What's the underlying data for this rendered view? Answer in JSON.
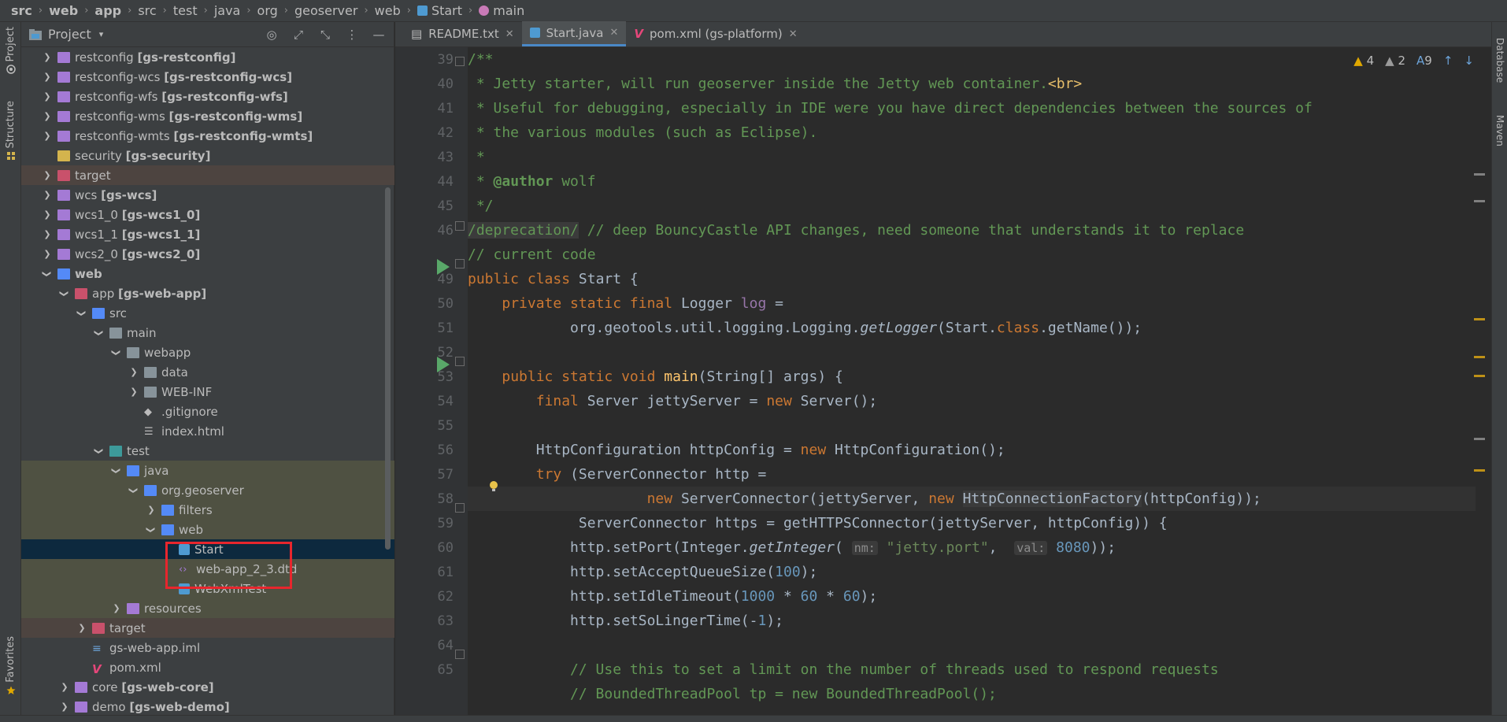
{
  "breadcrumb": [
    {
      "label": "src",
      "bold": true
    },
    {
      "label": "web",
      "bold": true
    },
    {
      "label": "app",
      "bold": true
    },
    {
      "label": "src",
      "bold": false
    },
    {
      "label": "test",
      "bold": false
    },
    {
      "label": "java",
      "bold": false
    },
    {
      "label": "org",
      "bold": false
    },
    {
      "label": "geoserver",
      "bold": false
    },
    {
      "label": "web",
      "bold": false
    },
    {
      "label": "Start",
      "bold": false
    },
    {
      "label": "main",
      "bold": false
    }
  ],
  "left_stripe": {
    "project": "Project",
    "structure": "Structure",
    "favorites": "Favorites"
  },
  "right_stripe": {
    "database": "Database",
    "maven": "Maven"
  },
  "project_panel": {
    "title": "Project"
  },
  "tree": [
    {
      "indent": 1,
      "arrow": "right",
      "icon": "mod",
      "label": "restconfig ",
      "bold": "[gs-restconfig]"
    },
    {
      "indent": 1,
      "arrow": "right",
      "icon": "mod",
      "label": "restconfig-wcs ",
      "bold": "[gs-restconfig-wcs]"
    },
    {
      "indent": 1,
      "arrow": "right",
      "icon": "mod",
      "label": "restconfig-wfs ",
      "bold": "[gs-restconfig-wfs]"
    },
    {
      "indent": 1,
      "arrow": "right",
      "icon": "mod",
      "label": "restconfig-wms ",
      "bold": "[gs-restconfig-wms]"
    },
    {
      "indent": 1,
      "arrow": "right",
      "icon": "mod",
      "label": "restconfig-wmts ",
      "bold": "[gs-restconfig-wmts]"
    },
    {
      "indent": 1,
      "arrow": "none",
      "icon": "sec",
      "label": "security ",
      "bold": "[gs-security]"
    },
    {
      "indent": 1,
      "arrow": "right",
      "icon": "pink",
      "label": "target",
      "bold": "",
      "style": "tgt"
    },
    {
      "indent": 1,
      "arrow": "right",
      "icon": "mod",
      "label": "wcs ",
      "bold": "[gs-wcs]"
    },
    {
      "indent": 1,
      "arrow": "right",
      "icon": "mod",
      "label": "wcs1_0 ",
      "bold": "[gs-wcs1_0]"
    },
    {
      "indent": 1,
      "arrow": "right",
      "icon": "mod",
      "label": "wcs1_1 ",
      "bold": "[gs-wcs1_1]"
    },
    {
      "indent": 1,
      "arrow": "right",
      "icon": "mod",
      "label": "wcs2_0 ",
      "bold": "[gs-wcs2_0]"
    },
    {
      "indent": 1,
      "arrow": "down",
      "icon": "blue",
      "label": "",
      "bold": "web"
    },
    {
      "indent": 2,
      "arrow": "down",
      "icon": "pink",
      "label": "app ",
      "bold": "[gs-web-app]"
    },
    {
      "indent": 3,
      "arrow": "down",
      "icon": "blue",
      "label": "src",
      "bold": ""
    },
    {
      "indent": 4,
      "arrow": "down",
      "icon": "gray",
      "label": "main",
      "bold": ""
    },
    {
      "indent": 5,
      "arrow": "down",
      "icon": "gray",
      "label": "webapp",
      "bold": ""
    },
    {
      "indent": 6,
      "arrow": "right",
      "icon": "gray",
      "label": "data",
      "bold": ""
    },
    {
      "indent": 6,
      "arrow": "right",
      "icon": "gray",
      "label": "WEB-INF",
      "bold": ""
    },
    {
      "indent": 6,
      "arrow": "none",
      "icon": "git",
      "label": ".gitignore",
      "bold": ""
    },
    {
      "indent": 6,
      "arrow": "none",
      "icon": "html",
      "label": "index.html",
      "bold": ""
    },
    {
      "indent": 4,
      "arrow": "down",
      "icon": "teal",
      "label": "test",
      "bold": ""
    },
    {
      "indent": 5,
      "arrow": "down",
      "icon": "blue",
      "label": "java",
      "bold": "",
      "style": "hl"
    },
    {
      "indent": 6,
      "arrow": "down",
      "icon": "blue",
      "label": "org.geoserver",
      "bold": "",
      "style": "hl"
    },
    {
      "indent": 7,
      "arrow": "right",
      "icon": "blue",
      "label": "filters",
      "bold": "",
      "style": "hl"
    },
    {
      "indent": 7,
      "arrow": "down",
      "icon": "blue",
      "label": "web",
      "bold": "",
      "style": "hl"
    },
    {
      "indent": 8,
      "arrow": "none",
      "icon": "class",
      "label": "Start",
      "bold": "",
      "style": "sel"
    },
    {
      "indent": 8,
      "arrow": "none",
      "icon": "dtd",
      "label": "web-app_2_3.dtd",
      "bold": "",
      "style": "hl"
    },
    {
      "indent": 8,
      "arrow": "none",
      "icon": "class",
      "label": "WebXmlTest",
      "bold": "",
      "style": "hl"
    },
    {
      "indent": 5,
      "arrow": "right",
      "icon": "res",
      "label": "resources",
      "bold": "",
      "style": "hl"
    },
    {
      "indent": 3,
      "arrow": "right",
      "icon": "pink",
      "label": "target",
      "bold": "",
      "style": "tgt"
    },
    {
      "indent": 3,
      "arrow": "none",
      "icon": "iml",
      "label": "gs-web-app.iml",
      "bold": ""
    },
    {
      "indent": 3,
      "arrow": "none",
      "icon": "maven",
      "label": "pom.xml",
      "bold": ""
    },
    {
      "indent": 2,
      "arrow": "right",
      "icon": "mod",
      "label": "core ",
      "bold": "[gs-web-core]"
    },
    {
      "indent": 2,
      "arrow": "right",
      "icon": "mod",
      "label": "demo ",
      "bold": "[gs-web-demo]"
    }
  ],
  "tabs": [
    {
      "label": "README.txt",
      "icon": "txt",
      "active": false
    },
    {
      "label": "Start.java",
      "icon": "class",
      "active": true
    },
    {
      "label": "pom.xml (gs-platform)",
      "icon": "maven",
      "active": false
    }
  ],
  "inspections": {
    "warnings": "4",
    "weak_warnings": "2",
    "typos": "9"
  },
  "lines": [
    "39",
    "40",
    "41",
    "42",
    "43",
    "44",
    "45",
    "46",
    "",
    "49",
    "50",
    "51",
    "52",
    "53",
    "54",
    "55",
    "56",
    "57",
    "58",
    "59",
    "60",
    "61",
    "62",
    "63",
    "64",
    "65"
  ]
}
